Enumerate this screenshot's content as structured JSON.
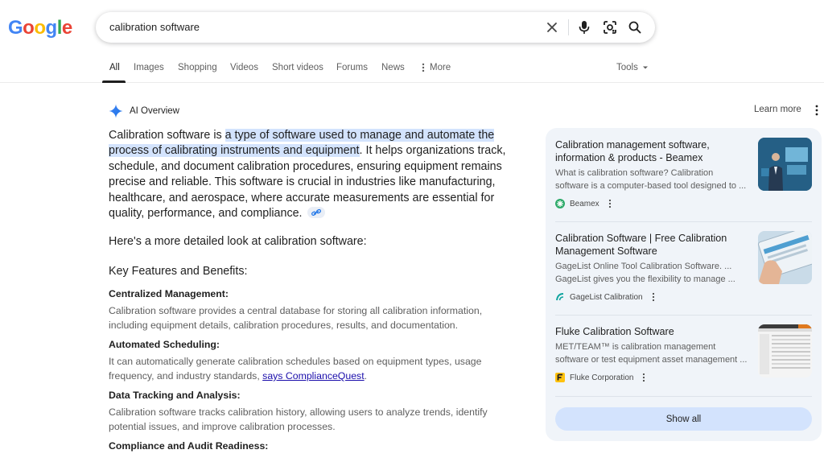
{
  "logo": {
    "letters": [
      "G",
      "o",
      "o",
      "g",
      "l",
      "e"
    ],
    "colors": [
      "#4285f4",
      "#ea4335",
      "#fbbc05",
      "#4285f4",
      "#34a853",
      "#ea4335"
    ]
  },
  "search": {
    "query": "calibration software"
  },
  "tabs": [
    {
      "label": "All",
      "active": true
    },
    {
      "label": "Images"
    },
    {
      "label": "Shopping"
    },
    {
      "label": "Videos"
    },
    {
      "label": "Short videos"
    },
    {
      "label": "Forums"
    },
    {
      "label": "News"
    },
    {
      "label": "More"
    }
  ],
  "tools_label": "Tools",
  "ai_overview": {
    "label": "AI Overview",
    "learn_more": "Learn more",
    "intro_pre": "Calibration software is ",
    "intro_highlight": "a type of software used to manage and automate the process of calibrating instruments and equipment",
    "intro_post": ". It helps organizations track, schedule, and document calibration procedures, ensuring equipment remains precise and reliable. This software is crucial in industries like manufacturing, healthcare, and aerospace, where accurate measurements are essential for quality, performance, and compliance.",
    "detail_line": "Here's a more detailed look at calibration software:",
    "section_heading": "Key Features and Benefits:",
    "features": [
      {
        "title": "Centralized Management:",
        "text": "Calibration software provides a central database for storing all calibration information, including equipment details, calibration procedures, results, and documentation."
      },
      {
        "title": "Automated Scheduling:",
        "text": "It can automatically generate calibration schedules based on equipment types, usage frequency, and industry standards, ",
        "link": "says ComplianceQuest",
        "text_after": "."
      },
      {
        "title": "Data Tracking and Analysis:",
        "text": "Calibration software tracks calibration history, allowing users to analyze trends, identify potential issues, and improve calibration processes."
      },
      {
        "title": "Compliance and Audit Readiness:"
      }
    ]
  },
  "sources": [
    {
      "title": "Calibration management software, information & products - Beamex",
      "desc_line1": "What is calibration software? Calibration",
      "desc_line2": "software is a computer-based tool designed to ...",
      "source": "Beamex"
    },
    {
      "title": "Calibration Software | Free Calibration Management Software",
      "desc_line1": "GageList Online Tool Calibration Software. ...",
      "desc_line2": "GageList gives you the flexibility to manage ...",
      "source": "GageList Calibration"
    },
    {
      "title": "Fluke Calibration Software",
      "desc_line1": "MET/TEAM™ is calibration management",
      "desc_line2": "software or test equipment asset management ...",
      "source": "Fluke Corporation"
    }
  ],
  "show_all": "Show all"
}
